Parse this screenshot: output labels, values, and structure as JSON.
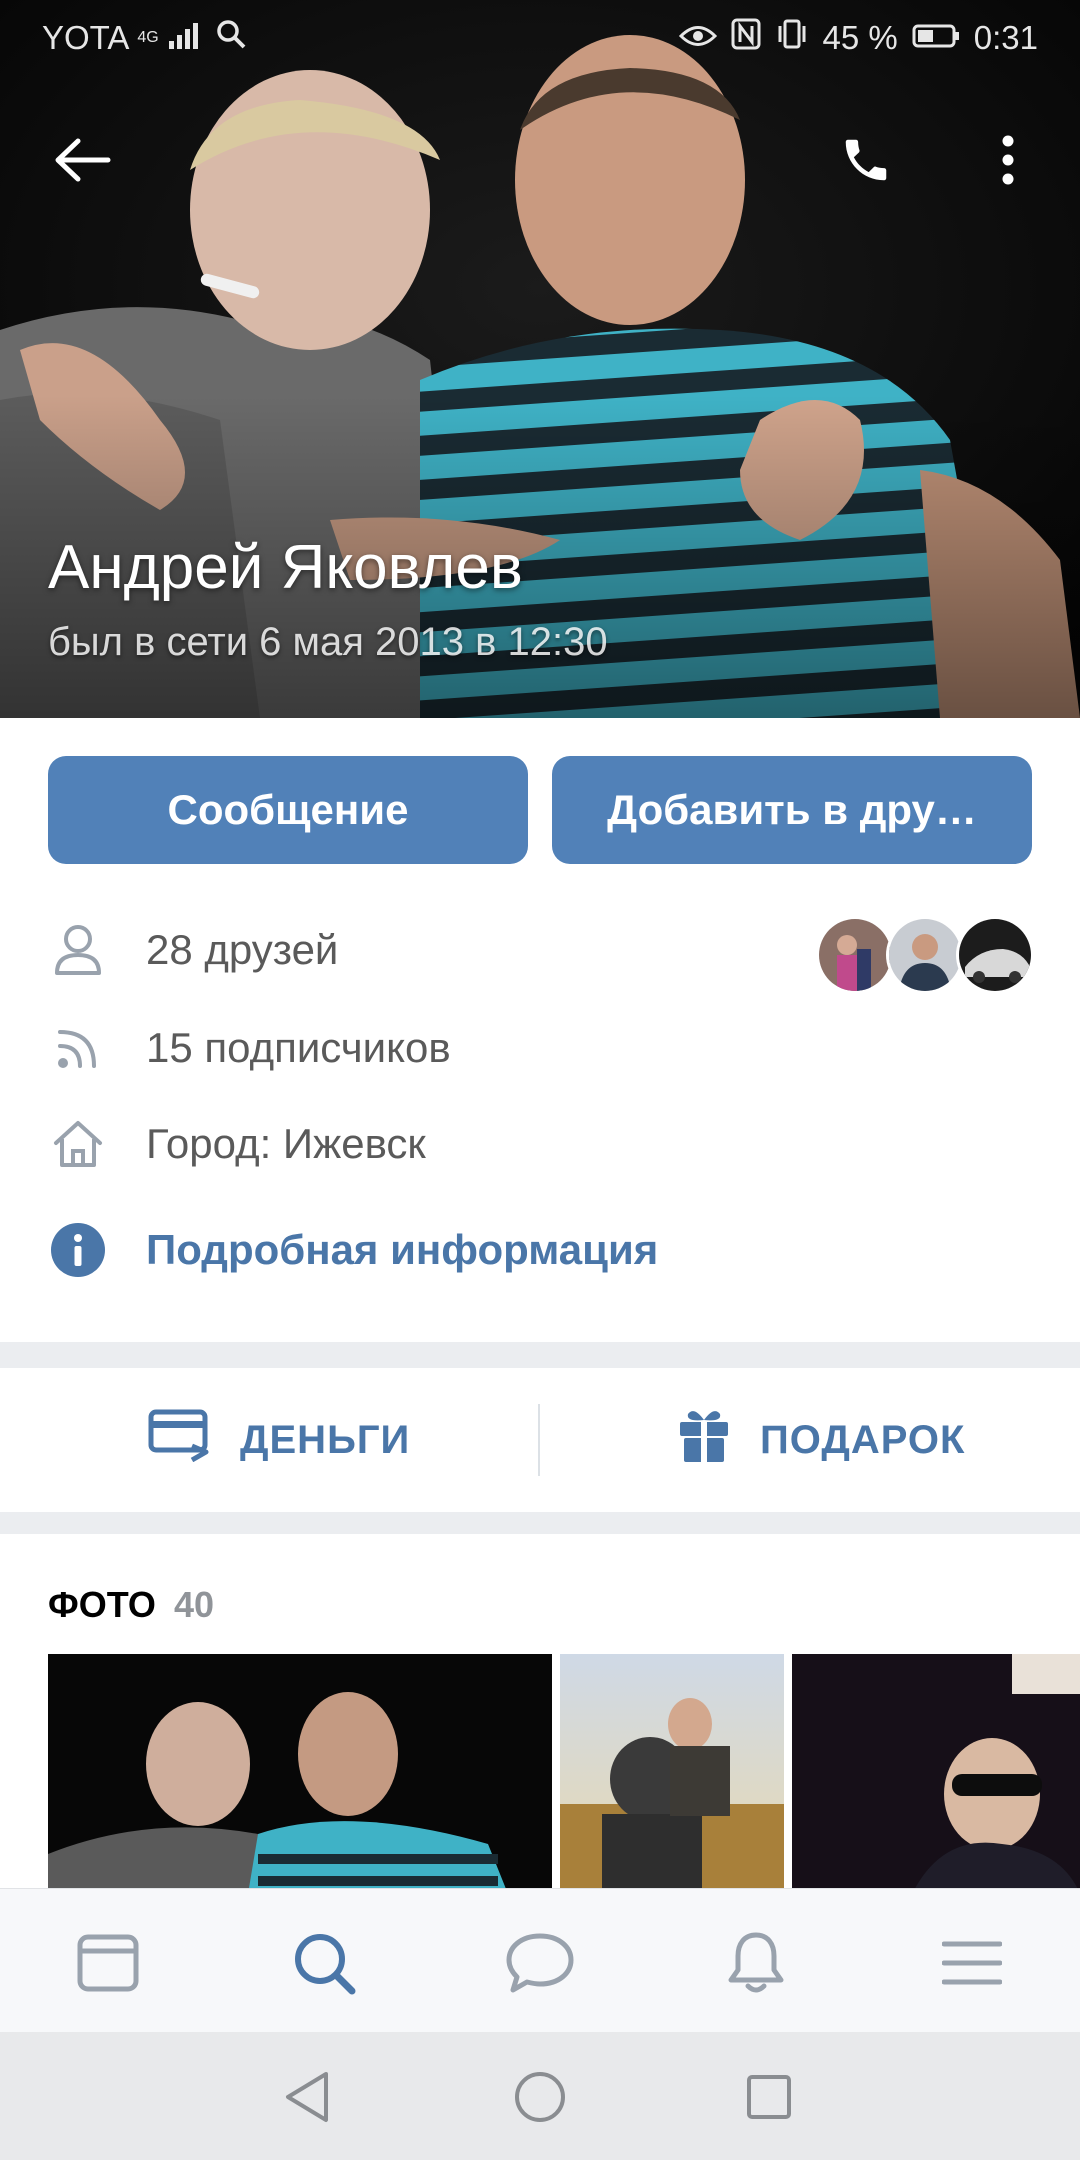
{
  "status_bar": {
    "carrier": "YOTA",
    "network": "4G",
    "battery": "45 %",
    "time": "0:31"
  },
  "profile": {
    "name": "Андрей Яковлев",
    "last_seen": "был в сети 6 мая 2013 в 12:30"
  },
  "buttons": {
    "message": "Сообщение",
    "add_friend": "Добавить в дру…"
  },
  "info": {
    "friends": "28 друзей",
    "followers": "15 подписчиков",
    "city": "Город: Ижевск",
    "details": "Подробная информация"
  },
  "actions": {
    "money": "ДЕНЬГИ",
    "gift": "ПОДАРОК"
  },
  "photos": {
    "title": "ФОТО",
    "count": "40"
  },
  "colors": {
    "accent": "#5181b8",
    "link": "#4a76a8",
    "icon_gray": "#99a2ad"
  },
  "icons": {
    "back": "arrow-left-icon",
    "call": "phone-icon",
    "more": "more-vertical-icon",
    "friends": "user-icon",
    "followers": "rss-icon",
    "city": "home-icon",
    "details": "info-icon",
    "money": "card-icon",
    "gift": "gift-icon",
    "tab_news": "newsfeed-icon",
    "tab_search": "search-icon",
    "tab_messages": "message-icon",
    "tab_notifications": "bell-icon",
    "tab_menu": "menu-icon"
  }
}
